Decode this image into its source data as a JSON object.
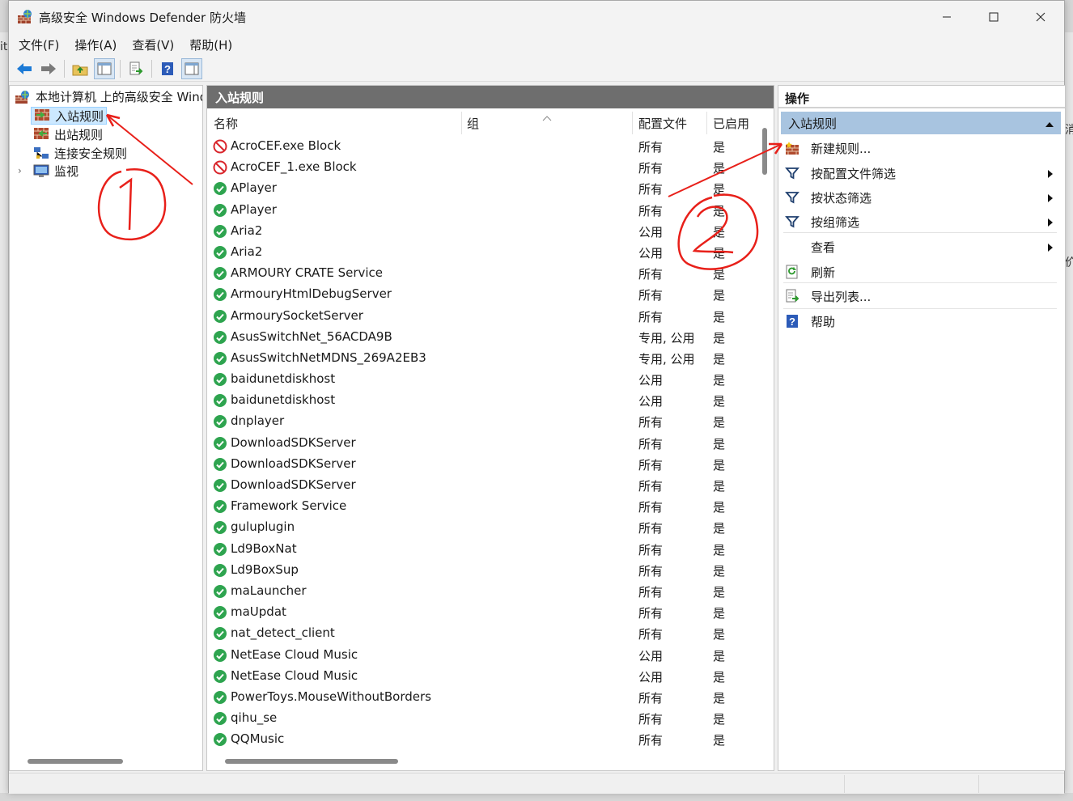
{
  "window": {
    "title": "高级安全 Windows Defender 防火墙"
  },
  "menu": [
    "文件(F)",
    "操作(A)",
    "查看(V)",
    "帮助(H)"
  ],
  "toolbar": {
    "buttons": [
      "back-arrow-icon",
      "forward-arrow-icon",
      "up-folder-icon",
      "show-hide-tree-icon",
      "export-list-icon",
      "help-icon",
      "show-hide-action-pane-icon"
    ]
  },
  "tree": {
    "root": "本地计算机 上的高级安全 Windo",
    "items": [
      "入站规则",
      "出站规则",
      "连接安全规则",
      "监视"
    ],
    "selected": "入站规则"
  },
  "center": {
    "header": "入站规则",
    "columns": [
      "名称",
      "组",
      "配置文件",
      "已启用"
    ],
    "rows": [
      {
        "name": "AcroCEF.exe Block",
        "profile": "所有",
        "enabled": "是",
        "status": "block"
      },
      {
        "name": "AcroCEF_1.exe Block",
        "profile": "所有",
        "enabled": "是",
        "status": "block"
      },
      {
        "name": "APlayer",
        "profile": "所有",
        "enabled": "是",
        "status": "allow"
      },
      {
        "name": "APlayer",
        "profile": "所有",
        "enabled": "是",
        "status": "allow"
      },
      {
        "name": "Aria2",
        "profile": "公用",
        "enabled": "是",
        "status": "allow"
      },
      {
        "name": "Aria2",
        "profile": "公用",
        "enabled": "是",
        "status": "allow"
      },
      {
        "name": "ARMOURY CRATE Service",
        "profile": "所有",
        "enabled": "是",
        "status": "allow"
      },
      {
        "name": "ArmouryHtmlDebugServer",
        "profile": "所有",
        "enabled": "是",
        "status": "allow"
      },
      {
        "name": "ArmourySocketServer",
        "profile": "所有",
        "enabled": "是",
        "status": "allow"
      },
      {
        "name": "AsusSwitchNet_56ACDA9B",
        "profile": "专用, 公用",
        "enabled": "是",
        "status": "allow"
      },
      {
        "name": "AsusSwitchNetMDNS_269A2EB3",
        "profile": "专用, 公用",
        "enabled": "是",
        "status": "allow"
      },
      {
        "name": "baidunetdiskhost",
        "profile": "公用",
        "enabled": "是",
        "status": "allow"
      },
      {
        "name": "baidunetdiskhost",
        "profile": "公用",
        "enabled": "是",
        "status": "allow"
      },
      {
        "name": "dnplayer",
        "profile": "所有",
        "enabled": "是",
        "status": "allow"
      },
      {
        "name": "DownloadSDKServer",
        "profile": "所有",
        "enabled": "是",
        "status": "allow"
      },
      {
        "name": "DownloadSDKServer",
        "profile": "所有",
        "enabled": "是",
        "status": "allow"
      },
      {
        "name": "DownloadSDKServer",
        "profile": "所有",
        "enabled": "是",
        "status": "allow"
      },
      {
        "name": "Framework Service",
        "profile": "所有",
        "enabled": "是",
        "status": "allow"
      },
      {
        "name": "guluplugin",
        "profile": "所有",
        "enabled": "是",
        "status": "allow"
      },
      {
        "name": "Ld9BoxNat",
        "profile": "所有",
        "enabled": "是",
        "status": "allow"
      },
      {
        "name": "Ld9BoxSup",
        "profile": "所有",
        "enabled": "是",
        "status": "allow"
      },
      {
        "name": "maLauncher",
        "profile": "所有",
        "enabled": "是",
        "status": "allow"
      },
      {
        "name": "maUpdat",
        "profile": "所有",
        "enabled": "是",
        "status": "allow"
      },
      {
        "name": "nat_detect_client",
        "profile": "所有",
        "enabled": "是",
        "status": "allow"
      },
      {
        "name": "NetEase Cloud Music",
        "profile": "公用",
        "enabled": "是",
        "status": "allow"
      },
      {
        "name": "NetEase Cloud Music",
        "profile": "公用",
        "enabled": "是",
        "status": "allow"
      },
      {
        "name": "PowerToys.MouseWithoutBorders",
        "profile": "所有",
        "enabled": "是",
        "status": "allow"
      },
      {
        "name": "qihu_se",
        "profile": "所有",
        "enabled": "是",
        "status": "allow"
      },
      {
        "name": "QQMusic",
        "profile": "所有",
        "enabled": "是",
        "status": "allow"
      }
    ]
  },
  "actions": {
    "title": "操作",
    "section": "入站规则",
    "items": [
      {
        "label": "新建规则...",
        "icon": "new-rule-icon",
        "submenu": false
      },
      {
        "label": "按配置文件筛选",
        "icon": "filter-icon",
        "submenu": true
      },
      {
        "label": "按状态筛选",
        "icon": "filter-icon",
        "submenu": true
      },
      {
        "label": "按组筛选",
        "icon": "filter-icon",
        "submenu": true
      },
      {
        "label": "查看",
        "icon": "",
        "submenu": true
      },
      {
        "label": "刷新",
        "icon": "refresh-icon",
        "submenu": false
      },
      {
        "label": "导出列表...",
        "icon": "export-list-icon",
        "submenu": false
      },
      {
        "label": "帮助",
        "icon": "help-icon",
        "submenu": false
      }
    ]
  },
  "background": {
    "left_fragment": "it",
    "right_fragment_1": "消",
    "right_fragment_2": "价"
  },
  "colors": {
    "pane_header": "#6e6e6e",
    "actions_section": "#a8c4e0",
    "selected_tree": "#cce8ff",
    "annotation": "#e8201a"
  }
}
